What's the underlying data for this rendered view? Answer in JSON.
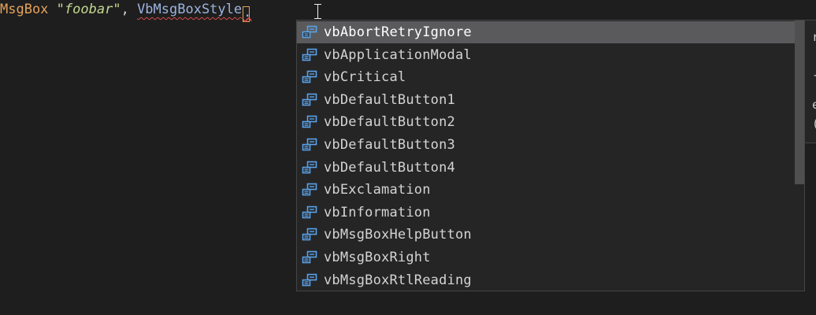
{
  "editor": {
    "tokens": {
      "call": "MsgBox",
      "space1": " ",
      "string": "\"foobar\"",
      "comma": ",",
      "space2": " ",
      "type": "VbMsgBoxStyle",
      "dot": "."
    }
  },
  "suggest": {
    "icon": "enum-member-icon",
    "selected_index": 0,
    "items": [
      "vbAbortRetryIgnore",
      "vbApplicationModal",
      "vbCritical",
      "vbDefaultButton1",
      "vbDefaultButton2",
      "vbDefaultButton3",
      "vbDefaultButton4",
      "vbExclamation",
      "vbInformation",
      "vbMsgBoxHelpButton",
      "vbMsgBoxRight",
      "vbMsgBoxRtlReading"
    ]
  },
  "details": {
    "fragments": [
      "r",
      "-",
      "e",
      "("
    ]
  },
  "colors": {
    "background": "#1e1e1e",
    "widget_background": "#252526",
    "selected_row": "#5a5a5c",
    "call": "#e5a35a",
    "string": "#c3d78f",
    "type": "#9cb4e0",
    "error_squiggle": "#d94a4a",
    "icon": "#5aa2e8"
  }
}
